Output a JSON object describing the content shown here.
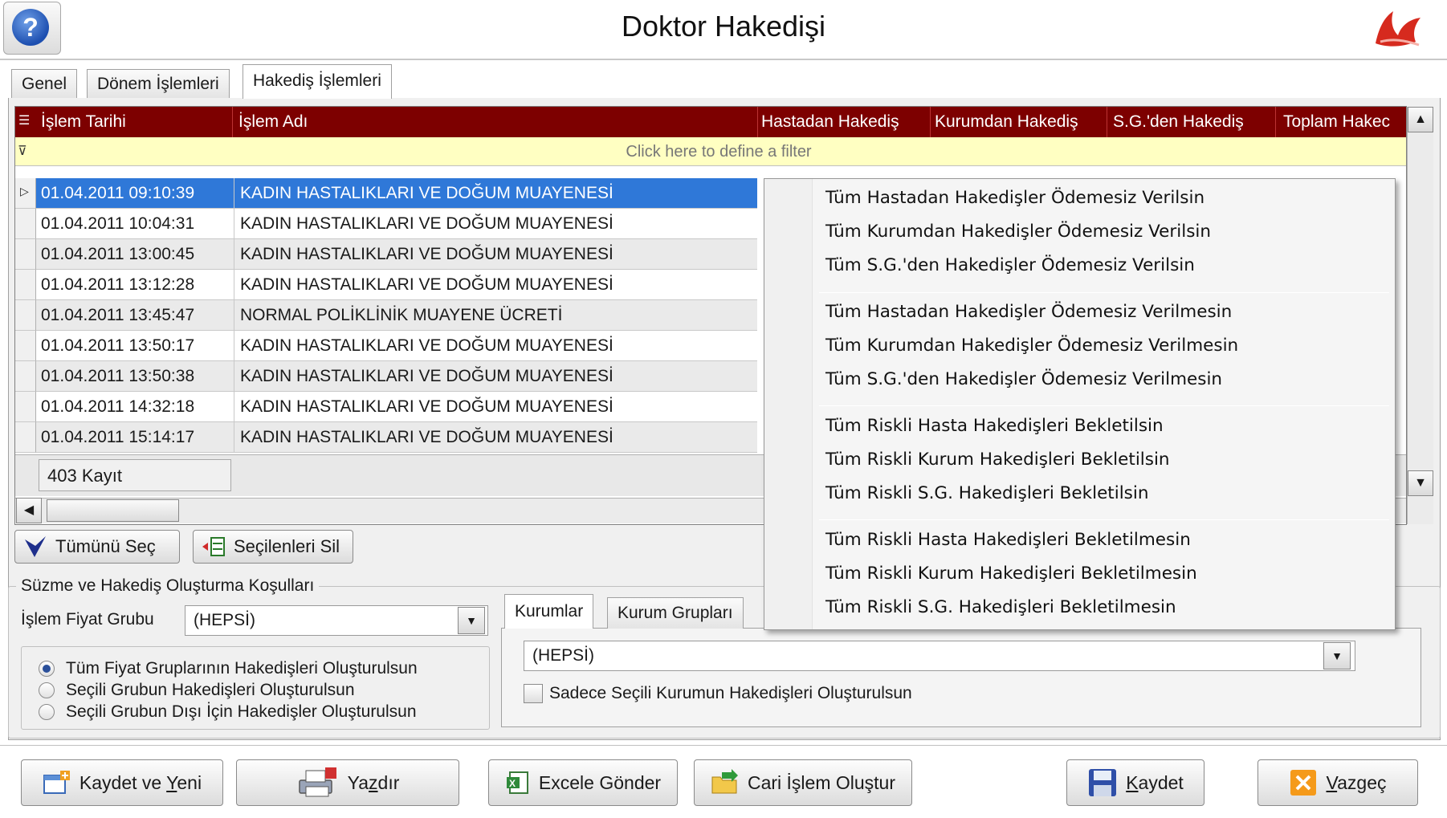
{
  "window": {
    "title": "Doktor Hakedişi",
    "help_icon": "question-mark-icon",
    "logo_icon": "brand-logo-icon"
  },
  "tabs": [
    {
      "label": "Genel",
      "active": false
    },
    {
      "label": "Dönem İşlemleri",
      "active": false
    },
    {
      "label": "Hakediş İşlemleri",
      "active": true
    }
  ],
  "grid": {
    "columns": [
      "İşlem Tarihi",
      "İşlem Adı",
      "Hastadan Hakediş",
      "Kurumdan Hakediş",
      "S.G.'den Hakediş",
      "Toplam Hakec"
    ],
    "filter_placeholder": "Click here to define a filter",
    "rows": [
      {
        "date": "01.04.2011 09:10:39",
        "name": "KADIN HASTALIKLARI VE DOĞUM MUAYENESİ",
        "selected": true
      },
      {
        "date": "01.04.2011 10:04:31",
        "name": "KADIN HASTALIKLARI VE DOĞUM MUAYENESİ"
      },
      {
        "date": "01.04.2011 13:00:45",
        "name": "KADIN HASTALIKLARI VE DOĞUM MUAYENESİ"
      },
      {
        "date": "01.04.2011 13:12:28",
        "name": "KADIN HASTALIKLARI VE DOĞUM MUAYENESİ"
      },
      {
        "date": "01.04.2011 13:45:47",
        "name": "NORMAL POLİKLİNİK MUAYENE ÜCRETİ"
      },
      {
        "date": "01.04.2011 13:50:17",
        "name": "KADIN HASTALIKLARI VE DOĞUM MUAYENESİ"
      },
      {
        "date": "01.04.2011 13:50:38",
        "name": "KADIN HASTALIKLARI VE DOĞUM MUAYENESİ"
      },
      {
        "date": "01.04.2011 14:32:18",
        "name": "KADIN HASTALIKLARI VE DOĞUM MUAYENESİ"
      },
      {
        "date": "01.04.2011 15:14:17",
        "name": "KADIN HASTALIKLARI VE DOĞUM MUAYENESİ"
      }
    ],
    "record_count": "403 Kayıt"
  },
  "actions": {
    "select_all": "Tümünü Seç",
    "delete_selected": "Seçilenleri Sil"
  },
  "filter_group": {
    "legend": "Süzme ve Hakediş Oluşturma Koşulları",
    "price_group_label": "İşlem Fiyat Grubu",
    "price_group_value": "(HEPSİ)",
    "radios": [
      {
        "label": "Tüm Fiyat Gruplarının Hakedişleri Oluşturulsun",
        "checked": true
      },
      {
        "label": "Seçili Grubun Hakedişleri Oluşturulsun",
        "checked": false
      },
      {
        "label": "Seçili Grubun Dışı İçin Hakedişler Oluşturulsun",
        "checked": false
      }
    ],
    "sub_tabs": [
      "Kurumlar",
      "Kurum Grupları"
    ],
    "institution_value": "(HEPSİ)",
    "only_selected_label": "Sadece Seçili Kurumun Hakedişleri Oluşturulsun"
  },
  "context_menu": {
    "groups": [
      [
        "Tüm Hastadan Hakedişler Ödemesiz Verilsin",
        "Tüm Kurumdan Hakedişler Ödemesiz Verilsin",
        "Tüm S.G.'den Hakedişler Ödemesiz Verilsin"
      ],
      [
        "Tüm Hastadan Hakedişler Ödemesiz Verilmesin",
        "Tüm Kurumdan Hakedişler Ödemesiz Verilmesin",
        "Tüm S.G.'den Hakedişler Ödemesiz Verilmesin"
      ],
      [
        "Tüm Riskli Hasta Hakedişleri Bekletilsin",
        "Tüm Riskli Kurum Hakedişleri Bekletilsin",
        "Tüm Riskli S.G. Hakedişleri Bekletilsin"
      ],
      [
        "Tüm Riskli Hasta Hakedişleri Bekletilmesin",
        "Tüm Riskli Kurum Hakedişleri Bekletilmesin",
        "Tüm Riskli S.G. Hakedişleri Bekletilmesin"
      ]
    ]
  },
  "bottom_buttons": {
    "save_new": {
      "pre": "Kaydet ve ",
      "u": "Y",
      "post": "eni"
    },
    "print": {
      "pre": "Ya",
      "u": "z",
      "post": "dır"
    },
    "excel": "Excele Gönder",
    "cari": "Cari İşlem Oluştur",
    "save": {
      "pre": "",
      "u": "K",
      "post": "aydet"
    },
    "cancel": {
      "pre": "",
      "u": "V",
      "post": "azgeç"
    }
  },
  "colors": {
    "grid_header": "#7d0000",
    "selected_row": "#2f78d8",
    "filter_row": "#ffffc2"
  }
}
